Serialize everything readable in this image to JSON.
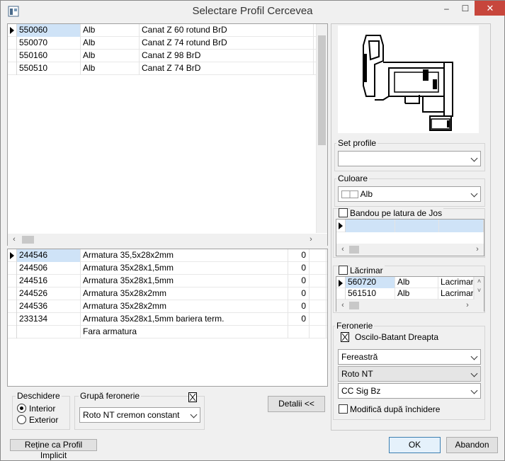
{
  "window": {
    "title": "Selectare Profil Cercevea",
    "min": "–",
    "max": "☐",
    "close": "✕"
  },
  "profiles": [
    {
      "code": "550060",
      "color": "Alb",
      "name": "Canat Z 60 rotund BrD"
    },
    {
      "code": "550070",
      "color": "Alb",
      "name": "Canat Z 74 rotund BrD"
    },
    {
      "code": "550160",
      "color": "Alb",
      "name": "Canat Z 98 BrD"
    },
    {
      "code": "550510",
      "color": "Alb",
      "name": "Canat Z 74 BrD"
    }
  ],
  "reinforcements": [
    {
      "code": "244546",
      "name": "Armatura 35,5x28x2mm",
      "qty": "0"
    },
    {
      "code": "244506",
      "name": "Armatura 35x28x1,5mm",
      "qty": "0"
    },
    {
      "code": "244516",
      "name": "Armatura 35x28x1,5mm",
      "qty": "0"
    },
    {
      "code": "244526",
      "name": "Armatura 35x28x2mm",
      "qty": "0"
    },
    {
      "code": "244536",
      "name": "Armatura 35x28x2mm",
      "qty": "0"
    },
    {
      "code": "233134",
      "name": "Armatura 35x28x1,5mm bariera term.",
      "qty": "0"
    },
    {
      "code": "",
      "name": "Fara armatura",
      "qty": ""
    }
  ],
  "opening": {
    "label": "Deschidere",
    "options": [
      "Interior",
      "Exterior"
    ],
    "selected": 0
  },
  "hardware_group": {
    "label": "Grupă feronerie",
    "value": "Roto NT cremon constant"
  },
  "details_button": "Detalii <<",
  "default_button": "Reține ca Profil Implicit",
  "ok_button": "OK",
  "cancel_button": "Abandon",
  "set_profile": {
    "label": "Set profile",
    "value": ""
  },
  "color_section": {
    "label": "Culoare",
    "value": "Alb"
  },
  "band": {
    "label": "Bandou pe latura de Jos",
    "checked": false
  },
  "drip": {
    "label": "Lăcrimar",
    "checked": false,
    "rows": [
      {
        "code": "560720",
        "color": "Alb",
        "name": "Lacrimar r"
      },
      {
        "code": "561510",
        "color": "Alb",
        "name": "Lacrimar r"
      }
    ]
  },
  "hardware": {
    "label": "Feronerie",
    "type": "Oscilo-Batant Dreapta",
    "window_type": "Fereastră",
    "system": "Roto NT",
    "lock": "CC Sig Bz",
    "modify_label": "Modifică după închidere",
    "modify_checked": false
  }
}
